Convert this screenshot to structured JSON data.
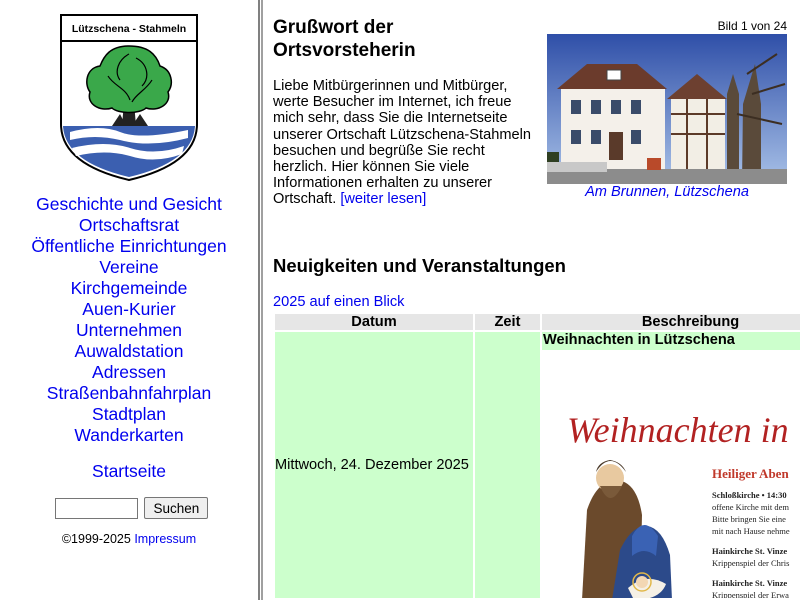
{
  "sidebar": {
    "crest_title": "Lützschena - Stahmeln",
    "nav": [
      "Geschichte und Gesicht",
      "Ortschaftsrat",
      "Öffentliche Einrichtungen",
      "Vereine",
      "Kirchgemeinde",
      "Auen-Kurier",
      "Unternehmen",
      "Auwaldstation",
      "Adressen",
      "Straßenbahnfahrplan",
      "Stadtplan",
      "Wanderkarten"
    ],
    "home": "Startseite",
    "search_value": "",
    "search_button": "Suchen",
    "copyright": "©1999-2025",
    "impressum": "Impressum"
  },
  "greeting": {
    "title": "Grußwort der Ortsvorsteherin",
    "text": "Liebe Mitbürgerinnen und Mitbürger, werte Besucher im Internet, ich freue mich sehr, dass Sie die Internetseite unserer Ortschaft Lützschena-Stahmeln besuchen und begrüße Sie recht herzlich. Hier können Sie viele Informationen erhalten zu unserer Ortschaft.",
    "more": "[weiter lesen]"
  },
  "gallery": {
    "counter": "Bild 1 von 24",
    "caption": "Am Brunnen, Lützschena"
  },
  "news": {
    "title": "Neuigkeiten und Veranstaltungen",
    "year_link": "2025 auf einen Blick",
    "columns": [
      "Datum",
      "Zeit",
      "Beschreibung"
    ],
    "rows": [
      {
        "date": "Mittwoch, 24. Dezember 2025",
        "time": "",
        "title": "Weihnachten in Lützschena"
      }
    ],
    "poster": {
      "headline": "Weihnachten in",
      "subhead": "Heiliger Aben",
      "lines": [
        "Schloßkirche • 14:30",
        "offene Kirche mit dem",
        "Bitte bringen Sie eine",
        "mit nach Hause nehme",
        "Hainkirche St. Vinze",
        "Krippenspiel der Chris",
        "Hainkirche St. Vinze",
        "Krippenspiel der Erwa"
      ]
    }
  },
  "colors": {
    "link": "#0000ee",
    "row_bg": "#ccffcc",
    "header_bg": "#e6e6e6",
    "poster_red": "#b22222"
  }
}
